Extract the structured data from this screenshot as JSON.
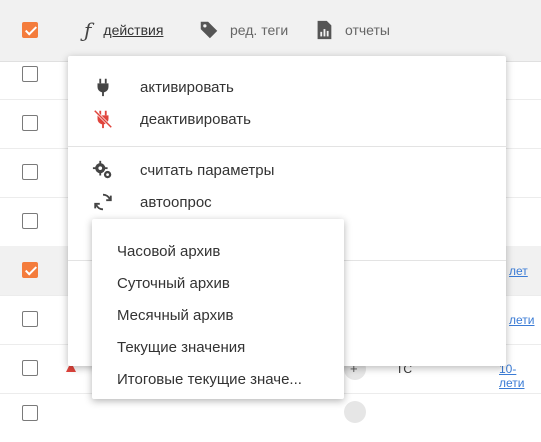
{
  "toolbar": {
    "actions_label": "действия",
    "edit_tags_label": "ред. теги",
    "reports_label": "отчеты"
  },
  "actions_menu": {
    "activate_label": "активировать",
    "deactivate_label": "деактивировать",
    "read_params_label": "считать параметры",
    "autopoll_label": "автоопрос"
  },
  "archive_submenu": {
    "items": [
      "Часовой архив",
      "Суточный архив",
      "Месячный архив",
      "Текущие значения",
      "Итоговые текущие значе..."
    ]
  },
  "table": {
    "rows": [
      {
        "checked": false
      },
      {
        "checked": false
      },
      {
        "checked": false
      },
      {
        "checked": false
      },
      {
        "checked": true
      },
      {
        "checked": false
      },
      {
        "checked": false
      }
    ],
    "visible_fragments": {
      "row5_link": "лет",
      "row6_link": "лети",
      "row7_text": "ТС",
      "row7_link": "10-лети"
    }
  },
  "colors": {
    "accent": "#f47c3c",
    "link": "#3a7bd5",
    "deactivate_icon": "#e0443c"
  }
}
